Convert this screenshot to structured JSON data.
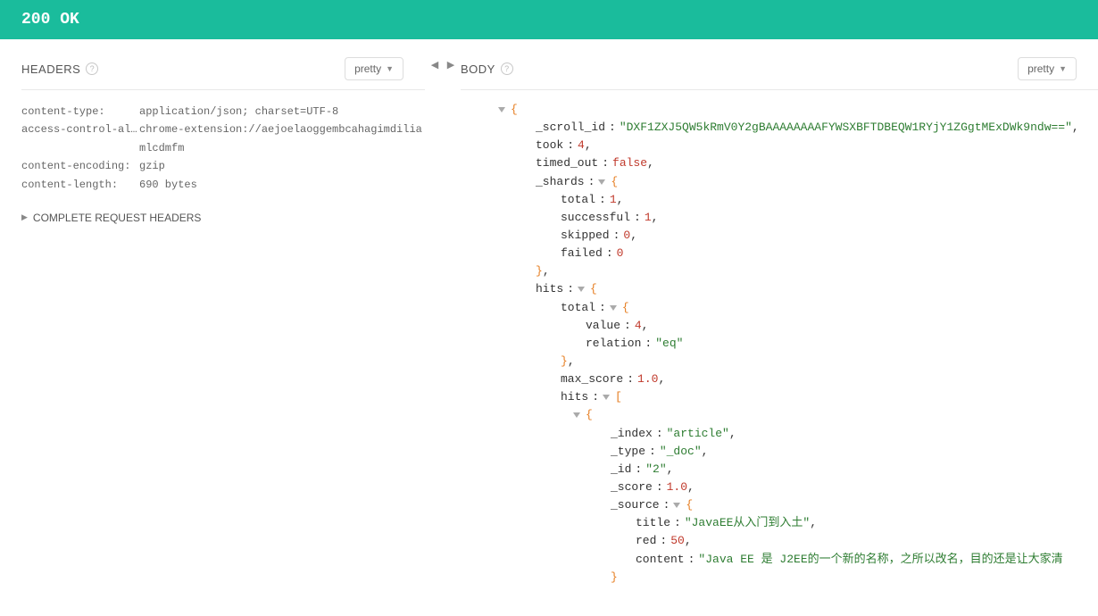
{
  "status": {
    "code": "200",
    "text": "OK"
  },
  "left": {
    "title": "HEADERS",
    "format_label": "pretty",
    "headers": [
      {
        "key": "content-type:",
        "value": "application/json; charset=UTF-8"
      },
      {
        "key": "access-control-all…",
        "value": "chrome-extension://aejoelaoggembcahagimdiliamlcdmfm"
      },
      {
        "key": "content-encoding:",
        "value": "gzip"
      },
      {
        "key": "content-length:",
        "value": "690 bytes"
      }
    ],
    "complete_label": "COMPLETE REQUEST HEADERS"
  },
  "right": {
    "title": "BODY",
    "format_label": "pretty",
    "json": {
      "scroll_id_key": "_scroll_id",
      "scroll_id_val": "\"DXF1ZXJ5QW5kRmV0Y2gBAAAAAAAAFYWSXBFTDBEQW1RYjY1ZGgtMExDWk9ndw==\"",
      "took_key": "took",
      "took_val": "4",
      "timed_out_key": "timed_out",
      "timed_out_val": "false",
      "shards_key": "_shards",
      "shards": {
        "total_key": "total",
        "total_val": "1",
        "successful_key": "successful",
        "successful_val": "1",
        "skipped_key": "skipped",
        "skipped_val": "0",
        "failed_key": "failed",
        "failed_val": "0"
      },
      "hits_key": "hits",
      "hits": {
        "total_key": "total",
        "total": {
          "value_key": "value",
          "value_val": "4",
          "relation_key": "relation",
          "relation_val": "\"eq\""
        },
        "max_score_key": "max_score",
        "max_score_val": "1.0",
        "inner_hits_key": "hits",
        "item0": {
          "index_key": "_index",
          "index_val": "\"article\"",
          "type_key": "_type",
          "type_val": "\"_doc\"",
          "id_key": "_id",
          "id_val": "\"2\"",
          "score_key": "_score",
          "score_val": "1.0",
          "source_key": "_source",
          "source": {
            "title_key": "title",
            "title_val": "\"JavaEE从入门到入土\"",
            "red_key": "red",
            "red_val": "50",
            "content_key": "content",
            "content_val": "\"Java EE 是 J2EE的一个新的名称，之所以改名，目的还是让大家清"
          }
        }
      }
    }
  }
}
